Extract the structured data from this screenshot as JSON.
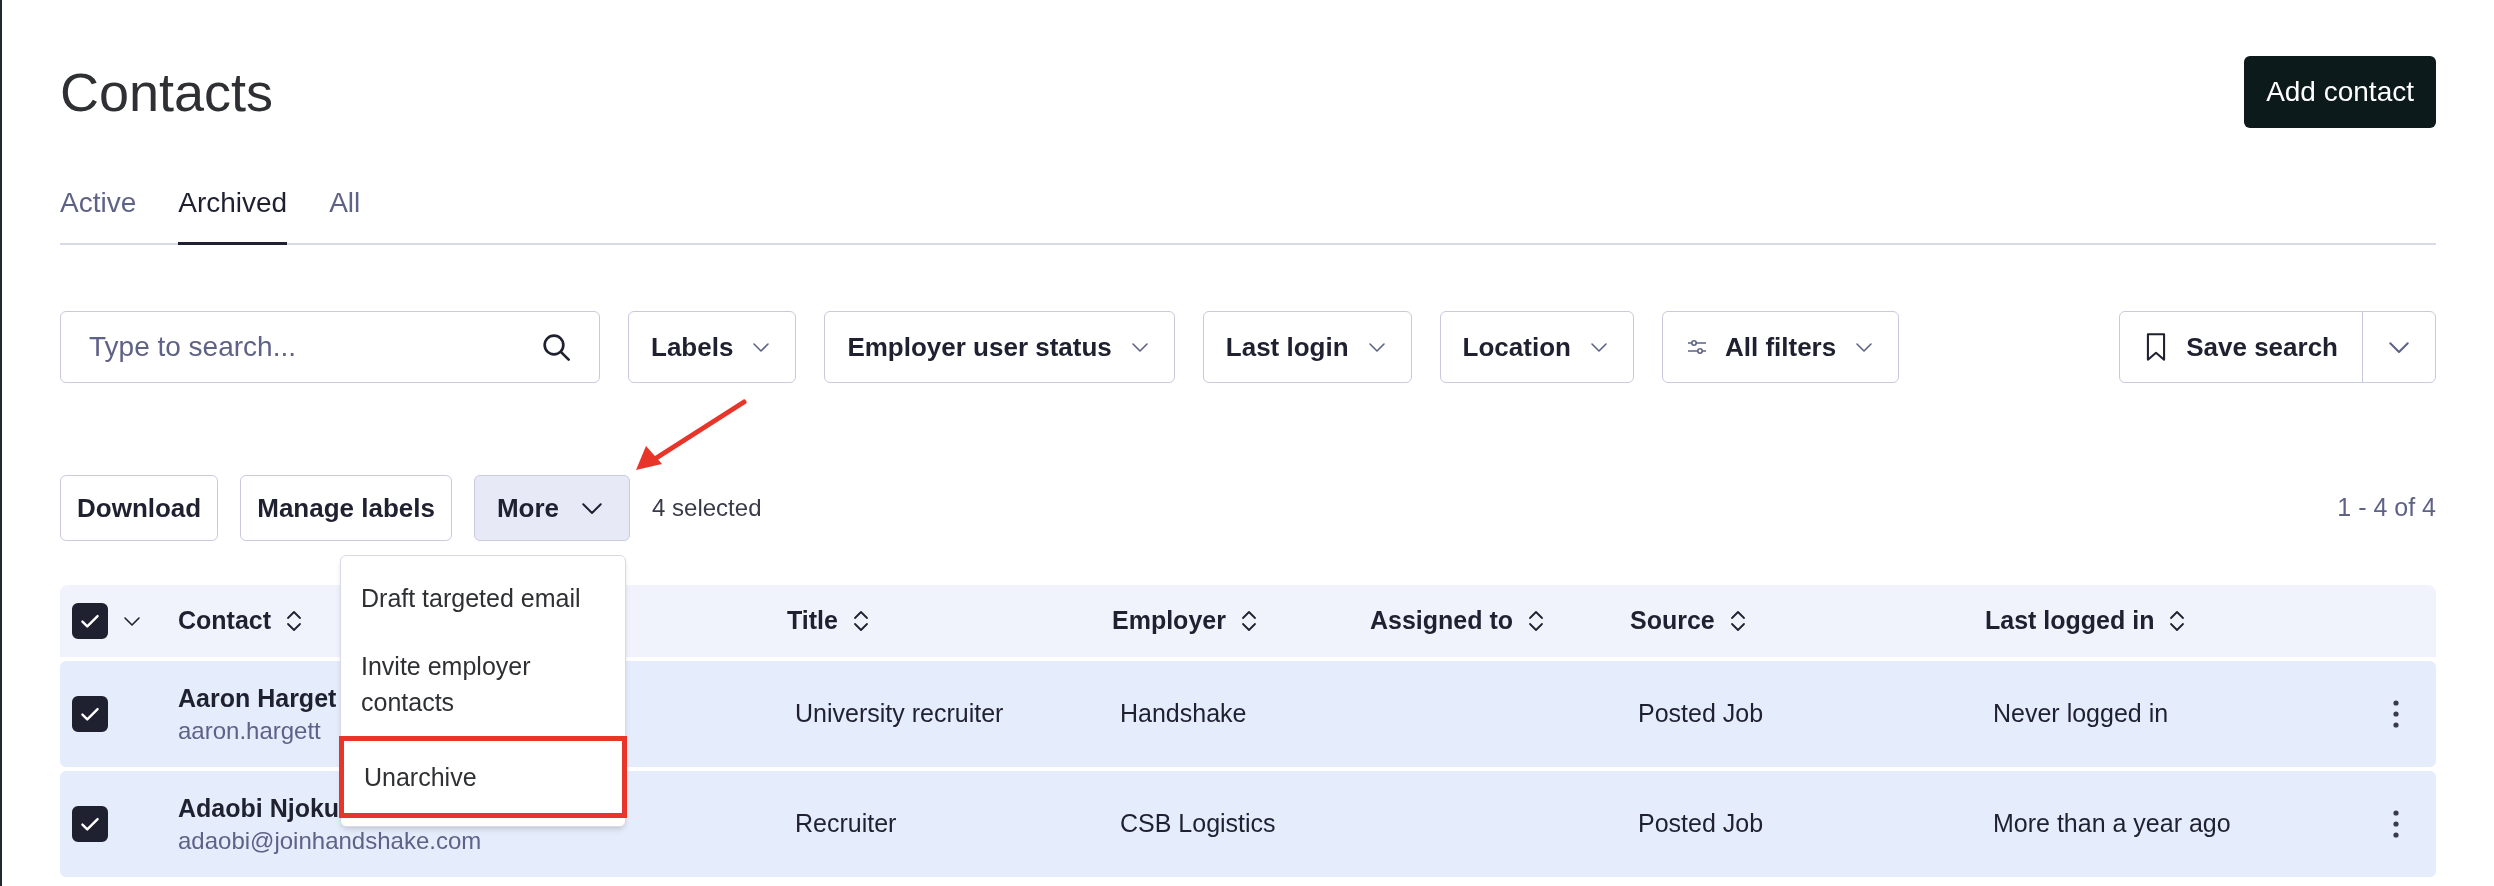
{
  "page": {
    "title": "Contacts",
    "primary_button": "Add contact"
  },
  "tabs": [
    {
      "label": "Active",
      "selected": false
    },
    {
      "label": "Archived",
      "selected": true
    },
    {
      "label": "All",
      "selected": false
    }
  ],
  "search": {
    "placeholder": "Type to search..."
  },
  "filters": [
    {
      "label": "Labels",
      "kind": "dropdown"
    },
    {
      "label": "Employer user status",
      "kind": "dropdown"
    },
    {
      "label": "Last login",
      "kind": "dropdown"
    },
    {
      "label": "Location",
      "kind": "dropdown"
    },
    {
      "label": "All filters",
      "kind": "all"
    }
  ],
  "save_search": {
    "label": "Save search"
  },
  "actions": [
    {
      "label": "Download",
      "kind": "button"
    },
    {
      "label": "Manage labels",
      "kind": "button"
    },
    {
      "label": "More",
      "kind": "menu",
      "expanded": true
    }
  ],
  "selection_count": "4 selected",
  "pagination": "1 - 4 of 4",
  "menu": {
    "items": [
      {
        "label": "Draft targeted email",
        "highlighted": false
      },
      {
        "label": "Invite employer contacts",
        "highlighted": false
      },
      {
        "label": "Unarchive",
        "highlighted": true
      }
    ]
  },
  "table": {
    "all_checked": true,
    "columns": [
      "Contact",
      "Title",
      "Employer",
      "Assigned to",
      "Source",
      "Last logged in"
    ],
    "rows": [
      {
        "checked": true,
        "name": "Aaron Harget",
        "email": "aaron.hargett",
        "title": "University recruiter",
        "employer": "Handshake",
        "source": "Posted Job",
        "last_logged_in": "Never logged in"
      },
      {
        "checked": true,
        "name": "Adaobi Njoku",
        "email": "adaobi@joinhandshake.com",
        "title": "Recruiter",
        "employer": "CSB Logistics",
        "source": "Posted Job",
        "last_logged_in": "More than a year ago"
      }
    ]
  }
}
